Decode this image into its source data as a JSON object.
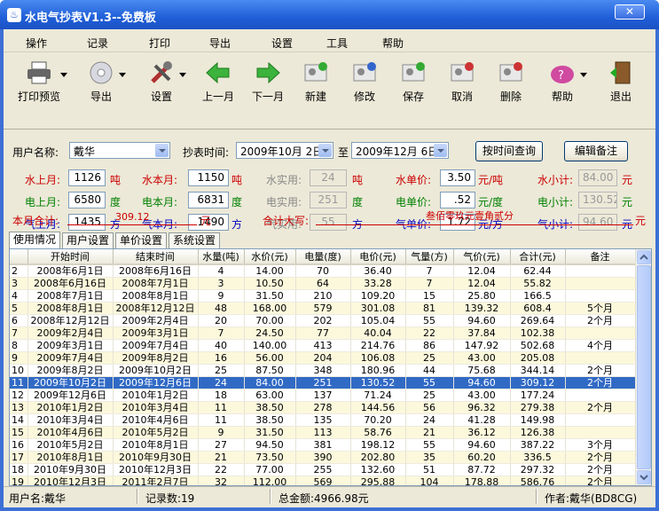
{
  "window": {
    "title": "水电气抄表V1.3--免费板",
    "close": "✕"
  },
  "menu": [
    "操作",
    "记录",
    "打印",
    "导出",
    "设置",
    "工具",
    "帮助"
  ],
  "toolbar": [
    {
      "label": "打印预览",
      "icon": "printer-icon"
    },
    {
      "label": "导出",
      "icon": "export-disc-icon"
    },
    {
      "label": "设置",
      "icon": "tools-icon"
    },
    {
      "label": "上一月",
      "icon": "arrow-left-icon"
    },
    {
      "label": "下一月",
      "icon": "arrow-right-icon"
    },
    {
      "label": "新建",
      "icon": "new-record-icon"
    },
    {
      "label": "修改",
      "icon": "edit-record-icon"
    },
    {
      "label": "保存",
      "icon": "save-record-icon"
    },
    {
      "label": "取消",
      "icon": "cancel-record-icon"
    },
    {
      "label": "删除",
      "icon": "delete-record-icon"
    },
    {
      "label": "帮助",
      "icon": "help-icon"
    },
    {
      "label": "退出",
      "icon": "exit-door-icon"
    }
  ],
  "form": {
    "user_label": "用户名称:",
    "user_value": "戴华",
    "time_label": "抄表时间:",
    "date_from": "2009年10月 2日",
    "to": "至",
    "date_to": "2009年12月 6日",
    "query_btn": "按时间查询",
    "edit_note_btn": "编辑备注",
    "water": {
      "last_label": "水上月:",
      "last": "1126",
      "this_label": "水本月:",
      "this": "1150",
      "unit": "吨",
      "used_label": "水实用:",
      "used": "24",
      "price_label": "水单价:",
      "price": "3.50",
      "price_unit": "元/吨",
      "sub_label": "水小计:",
      "sub": "84.00",
      "sub_unit": "元"
    },
    "elec": {
      "last_label": "电上月:",
      "last": "6580",
      "this_label": "电本月:",
      "this": "6831",
      "unit": "度",
      "used_label": "电实用:",
      "used": "251",
      "price_label": "电单价:",
      "price": ".52",
      "price_unit": "元/度",
      "sub_label": "电小计:",
      "sub": "130.52",
      "sub_unit": "元"
    },
    "gas": {
      "last_label": "气上月:",
      "last": "1435",
      "this_label": "气本月:",
      "this": "1490",
      "unit": "方",
      "used_label": "气实用:",
      "used": "55",
      "price_label": "气单价:",
      "price": "1.72",
      "price_unit": "元/方",
      "sub_label": "气小计:",
      "sub": "94.60",
      "sub_unit": "元"
    },
    "total_label": "本月合计:",
    "total_value": "309.12",
    "total_unit": "元",
    "caps_label": "合计大写:",
    "caps_value": "叁佰零玖元壹角贰分",
    "caps_unit": "元"
  },
  "tabs": [
    "使用情况",
    "用户设置",
    "单价设置",
    "系统设置"
  ],
  "grid": {
    "columns": [
      "",
      "开始时间",
      "结束时间",
      "水量(吨)",
      "水价(元)",
      "电量(度)",
      "电价(元)",
      "气量(方)",
      "气价(元)",
      "合计(元)",
      "备注"
    ],
    "rows": [
      [
        "2",
        "2008年6月1日",
        "2008年6月16日",
        "4",
        "14.00",
        "70",
        "36.40",
        "7",
        "12.04",
        "62.44",
        ""
      ],
      [
        "3",
        "2008年6月16日",
        "2008年7月1日",
        "3",
        "10.50",
        "64",
        "33.28",
        "7",
        "12.04",
        "55.82",
        ""
      ],
      [
        "4",
        "2008年7月1日",
        "2008年8月1日",
        "9",
        "31.50",
        "210",
        "109.20",
        "15",
        "25.80",
        "166.5",
        ""
      ],
      [
        "5",
        "2008年8月1日",
        "2008年12月12日",
        "48",
        "168.00",
        "579",
        "301.08",
        "81",
        "139.32",
        "608.4",
        "5个月"
      ],
      [
        "6",
        "2008年12月12日",
        "2009年2月4日",
        "20",
        "70.00",
        "202",
        "105.04",
        "55",
        "94.60",
        "269.64",
        "2个月"
      ],
      [
        "7",
        "2009年2月4日",
        "2009年3月1日",
        "7",
        "24.50",
        "77",
        "40.04",
        "22",
        "37.84",
        "102.38",
        ""
      ],
      [
        "8",
        "2009年3月1日",
        "2009年7月4日",
        "40",
        "140.00",
        "413",
        "214.76",
        "86",
        "147.92",
        "502.68",
        "4个月"
      ],
      [
        "9",
        "2009年7月4日",
        "2009年8月2日",
        "16",
        "56.00",
        "204",
        "106.08",
        "25",
        "43.00",
        "205.08",
        ""
      ],
      [
        "10",
        "2009年8月2日",
        "2009年10月2日",
        "25",
        "87.50",
        "348",
        "180.96",
        "44",
        "75.68",
        "344.14",
        "2个月"
      ],
      [
        "11",
        "2009年10月2日",
        "2009年12月6日",
        "24",
        "84.00",
        "251",
        "130.52",
        "55",
        "94.60",
        "309.12",
        "2个月"
      ],
      [
        "12",
        "2009年12月6日",
        "2010年1月2日",
        "18",
        "63.00",
        "137",
        "71.24",
        "25",
        "43.00",
        "177.24",
        ""
      ],
      [
        "13",
        "2010年1月2日",
        "2010年3月4日",
        "11",
        "38.50",
        "278",
        "144.56",
        "56",
        "96.32",
        "279.38",
        "2个月"
      ],
      [
        "14",
        "2010年3月4日",
        "2010年4月6日",
        "11",
        "38.50",
        "135",
        "70.20",
        "24",
        "41.28",
        "149.98",
        ""
      ],
      [
        "15",
        "2010年4月6日",
        "2010年5月2日",
        "9",
        "31.50",
        "113",
        "58.76",
        "21",
        "36.12",
        "126.38",
        ""
      ],
      [
        "16",
        "2010年5月2日",
        "2010年8月1日",
        "27",
        "94.50",
        "381",
        "198.12",
        "55",
        "94.60",
        "387.22",
        "3个月"
      ],
      [
        "17",
        "2010年8月1日",
        "2010年9月30日",
        "21",
        "73.50",
        "390",
        "202.80",
        "35",
        "60.20",
        "336.5",
        "2个月"
      ],
      [
        "18",
        "2010年9月30日",
        "2010年12月3日",
        "22",
        "77.00",
        "255",
        "132.60",
        "51",
        "87.72",
        "297.32",
        "2个月"
      ],
      [
        "19",
        "2010年12月3日",
        "2011年2月7日",
        "32",
        "112.00",
        "569",
        "295.88",
        "104",
        "178.88",
        "586.76",
        "2个月"
      ]
    ],
    "selected_row": 9
  },
  "status": {
    "user": "用户名:戴华",
    "count": "记录数:19",
    "total": "总金额:4966.98元",
    "author": "作者:戴华(BD8CG)"
  }
}
